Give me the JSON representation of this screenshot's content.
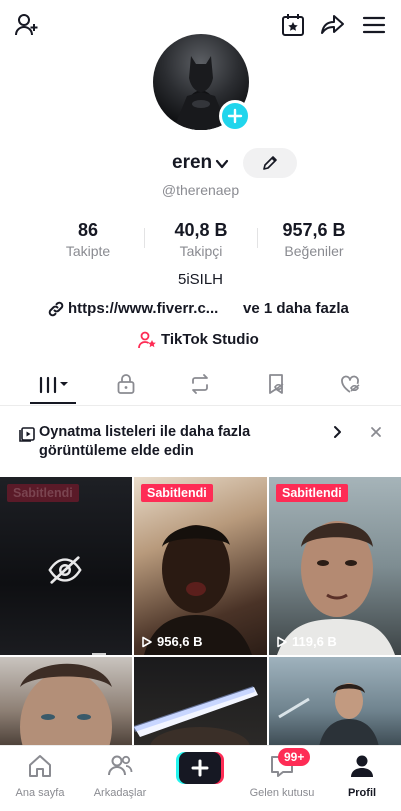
{
  "profile": {
    "username": "eren",
    "handle": "@therenaep",
    "bio": "5iSILH",
    "link": "https://www.fiverr.c...",
    "link_more": "ve 1 daha fazla",
    "studio": "TikTok Studio"
  },
  "stats": [
    {
      "value": "86",
      "label": "Takipte"
    },
    {
      "value": "40,8 B",
      "label": "Takipçi"
    },
    {
      "value": "957,6 B",
      "label": "Beğeniler"
    }
  ],
  "tabs": [
    "videos",
    "private",
    "reposts",
    "favorites",
    "liked"
  ],
  "banner": {
    "text": "Oynatma listeleri ile daha fazla görüntüleme elde edin"
  },
  "videos": [
    {
      "pinned": "Sabitlendi",
      "views": "",
      "hidden": true
    },
    {
      "pinned": "Sabitlendi",
      "views": "956,6 B"
    },
    {
      "pinned": "Sabitlendi",
      "views": "119,6 B"
    },
    {
      "pinned": "",
      "views": ""
    },
    {
      "pinned": "",
      "views": ""
    },
    {
      "pinned": "",
      "views": ""
    }
  ],
  "nav": {
    "home": "Ana sayfa",
    "friends": "Arkadaşlar",
    "inbox": "Gelen kutusu",
    "inbox_badge": "99+",
    "profile": "Profil"
  },
  "colors": {
    "accent": "#fe2c55",
    "cyan": "#20d5ec",
    "text": "#161823",
    "muted": "#8a8b91"
  }
}
